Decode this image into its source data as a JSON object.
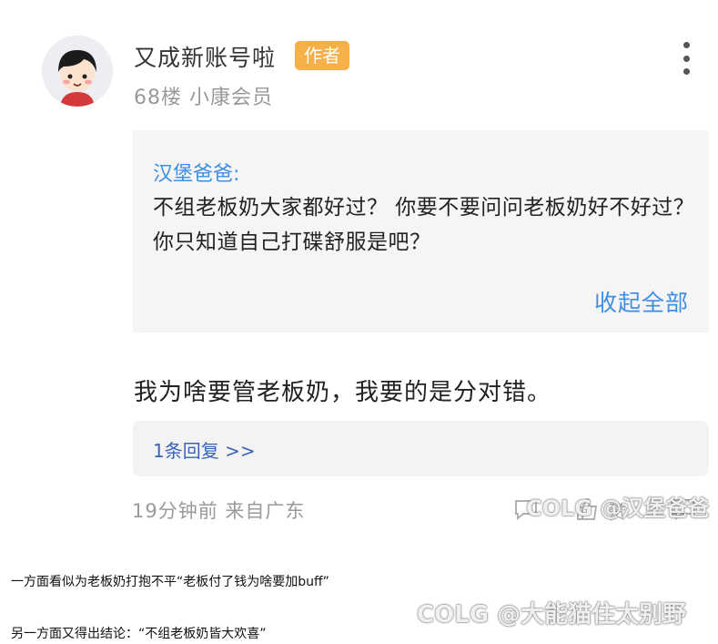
{
  "comment": {
    "username": "又成新账号啦",
    "author_badge": "作者",
    "floor": "68楼",
    "member_level": "小康会员",
    "quote": {
      "author": "汉堡爸爸:",
      "text": "不组老板奶大家都好过？ 你要不要问问老板奶好不好过？ 你只知道自己打碟舒服是吧？",
      "collapse_label": "收起全部"
    },
    "reply_text": "我为啥要管老板奶，我要的是分对错。",
    "replies_link": "1条回复 >>",
    "time": "19分钟前",
    "location": "来自广东",
    "like_label": "赞"
  },
  "watermarks": {
    "top": "COLG @汉堡爸爸",
    "bottom": "COLG @大能猫住太别野"
  },
  "captions": {
    "line1": "一方面看似为老板奶打抱不平“老板付了钱为啥要加buff”",
    "line2": "另一方面又得出结论：“不组老板奶皆大欢喜”"
  },
  "colors": {
    "accent_blue": "#3f8ee4",
    "link_blue": "#3a62b8",
    "badge_orange": "#f6b04a"
  },
  "icons": [
    "avatar",
    "more-icon",
    "comment-icon",
    "like-icon",
    "reply-icon"
  ]
}
